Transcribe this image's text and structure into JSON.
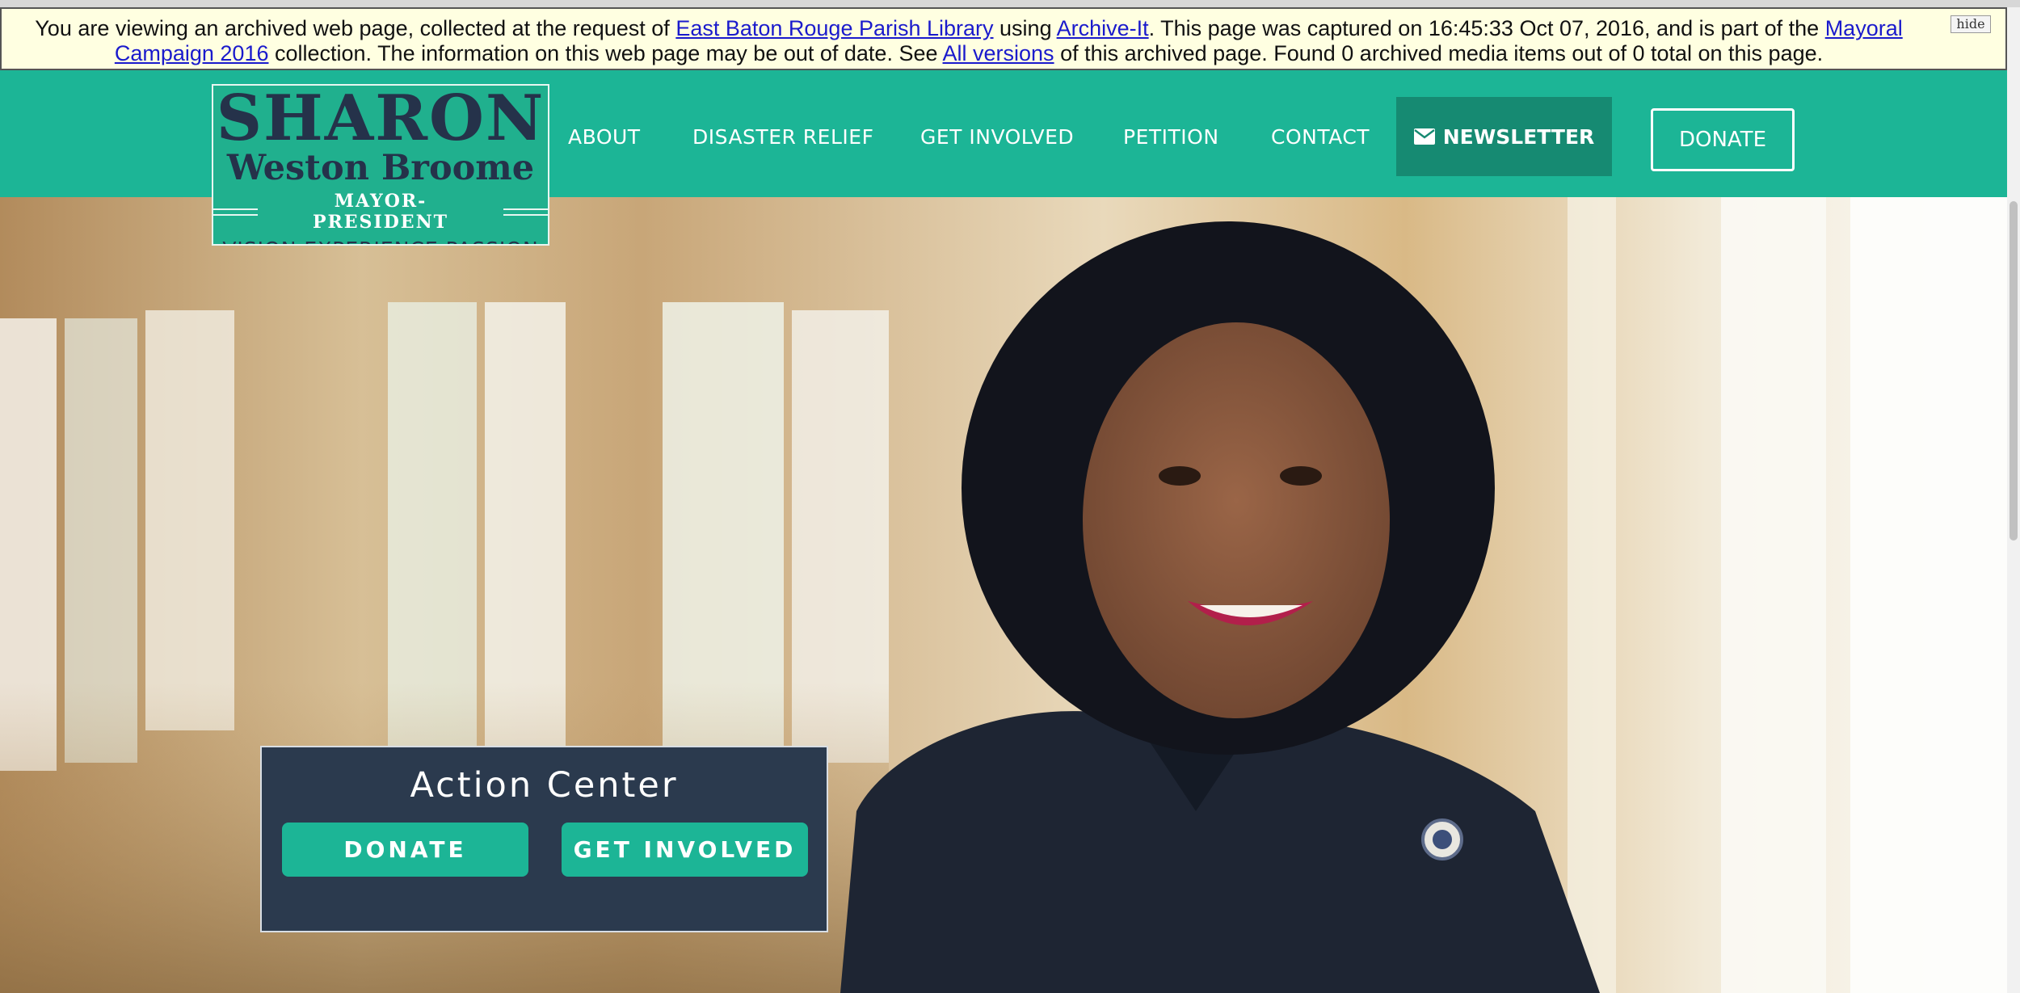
{
  "archive_banner": {
    "text_1": "You are viewing an archived web page, collected at the request of ",
    "link_library": "East Baton Rouge Parish Library",
    "text_2": " using ",
    "link_archiveit": "Archive-It",
    "text_3": ". This page was captured on 16:45:33 Oct 07, 2016, and is part of the ",
    "link_collection": "Mayoral Campaign 2016",
    "text_4": " collection. The information on this web page may be out of date. See ",
    "link_versions": "All versions",
    "text_5": " of this archived page. Found 0 archived media items out of 0 total on this page.",
    "hide_label": "hide"
  },
  "logo": {
    "name_line1": "SHARON",
    "name_line2": "Weston Broome",
    "role": "MAYOR-PRESIDENT",
    "tagline": "VISION  EXPERIENCE  PASSION"
  },
  "nav": {
    "items": [
      "ABOUT",
      "DISASTER RELIEF",
      "GET INVOLVED",
      "PETITION",
      "CONTACT"
    ],
    "newsletter_label": "NEWSLETTER",
    "newsletter_icon": "envelope-icon",
    "donate_label": "DONATE"
  },
  "action_center": {
    "title": "Action Center",
    "donate_label": "DONATE",
    "get_involved_label": "GET INVOLVED"
  },
  "colors": {
    "brand_teal": "#1cb596",
    "newsletter_bg": "#168a72",
    "navy": "#2b3a4e"
  }
}
